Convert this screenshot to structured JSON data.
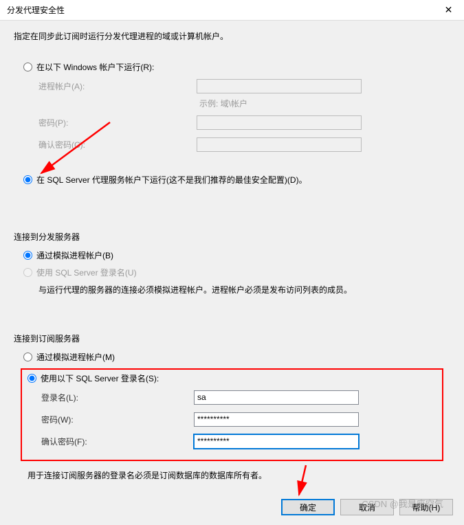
{
  "titlebar": {
    "title": "分发代理安全性",
    "close": "✕"
  },
  "instruction": "指定在同步此订阅时运行分发代理进程的域或计算机帐户。",
  "runAs": {
    "windowsOption": "在以下 Windows 帐户下运行(R):",
    "processAccountLabel": "进程帐户(A):",
    "processAccountHint": "示例: 域\\帐户",
    "passwordLabel": "密码(P):",
    "confirmPasswordLabel": "确认密码(C):",
    "sqlAgentOption": "在 SQL Server 代理服务帐户下运行(这不是我们推荐的最佳安全配置)(D)。"
  },
  "distributor": {
    "title": "连接到分发服务器",
    "impersonateOption": "通过模拟进程帐户(B)",
    "sqlLoginOption": "使用 SQL Server 登录名(U)",
    "info": "与运行代理的服务器的连接必须模拟进程帐户。进程帐户必须是发布访问列表的成员。"
  },
  "subscriber": {
    "title": "连接到订阅服务器",
    "impersonateOption": "通过模拟进程帐户(M)",
    "sqlLoginOption": "使用以下 SQL Server 登录名(S):",
    "loginLabel": "登录名(L):",
    "loginValue": "sa",
    "passwordLabel": "密码(W):",
    "passwordValue": "**********",
    "confirmPasswordLabel": "确认密码(F):",
    "confirmPasswordValue": "**********",
    "info": "用于连接订阅服务器的登录名必须是订阅数据库的数据库所有者。"
  },
  "buttons": {
    "ok": "确定",
    "cancel": "取消",
    "help": "帮助(H)"
  },
  "watermark": "CSDN @我是废空气"
}
